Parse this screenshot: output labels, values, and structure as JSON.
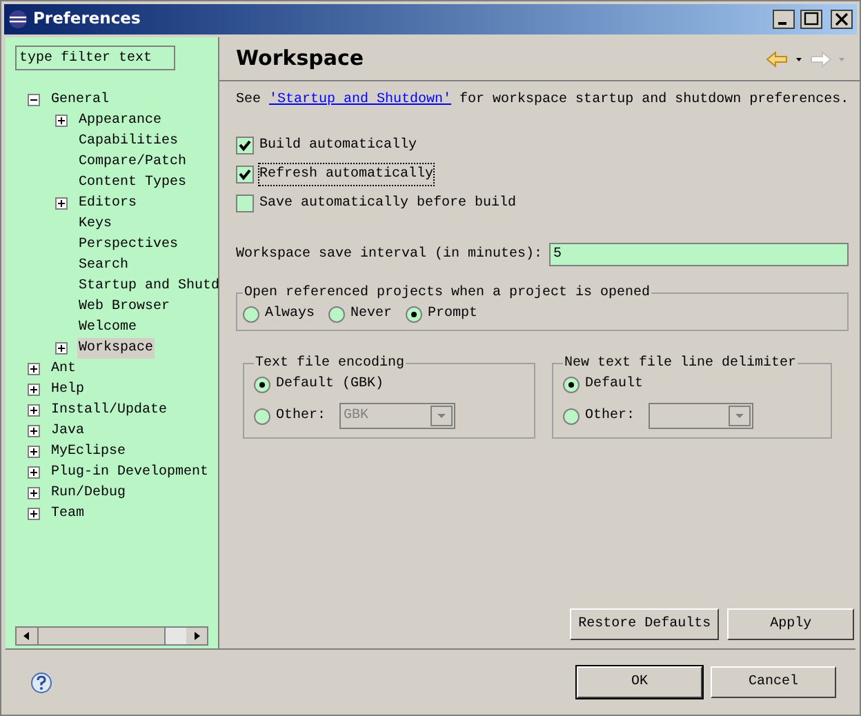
{
  "window": {
    "title": "Preferences"
  },
  "filter": {
    "placeholder": "type filter text"
  },
  "tree": [
    {
      "label": "General",
      "expanded": true,
      "selected": false,
      "children": [
        {
          "label": "Appearance",
          "expanded": false,
          "selected": false
        },
        {
          "label": "Capabilities",
          "selected": false
        },
        {
          "label": "Compare/Patch",
          "selected": false
        },
        {
          "label": "Content Types",
          "selected": false
        },
        {
          "label": "Editors",
          "expanded": false,
          "selected": false
        },
        {
          "label": "Keys",
          "selected": false
        },
        {
          "label": "Perspectives",
          "selected": false
        },
        {
          "label": "Search",
          "selected": false
        },
        {
          "label": "Startup and Shutd",
          "selected": false
        },
        {
          "label": "Web Browser",
          "selected": false
        },
        {
          "label": "Welcome",
          "selected": false
        },
        {
          "label": "Workspace",
          "expanded": false,
          "selected": true
        }
      ]
    },
    {
      "label": "Ant",
      "expanded": false,
      "selected": false
    },
    {
      "label": "Help",
      "expanded": false,
      "selected": false
    },
    {
      "label": "Install/Update",
      "expanded": false,
      "selected": false
    },
    {
      "label": "Java",
      "expanded": false,
      "selected": false
    },
    {
      "label": "MyEclipse",
      "expanded": false,
      "selected": false
    },
    {
      "label": "Plug-in Development",
      "expanded": false,
      "selected": false
    },
    {
      "label": "Run/Debug",
      "expanded": false,
      "selected": false
    },
    {
      "label": "Team",
      "expanded": false,
      "selected": false
    }
  ],
  "page": {
    "title": "Workspace",
    "intro": {
      "before": "See",
      "link": "'Startup and Shutdown'",
      "after": "for workspace startup and shutdown preferences."
    },
    "checkboxes": [
      {
        "label": "Build automatically",
        "checked": true
      },
      {
        "label": "Refresh automatically",
        "checked": true
      },
      {
        "label": "Save automatically before build",
        "checked": false
      }
    ],
    "interval": {
      "label": "Workspace save interval (in minutes):",
      "value": "5"
    },
    "open_projects": {
      "title": "Open referenced projects when a project is opened",
      "options": [
        {
          "label": "Always",
          "selected": false
        },
        {
          "label": "Never",
          "selected": false
        },
        {
          "label": "Prompt",
          "selected": true
        }
      ]
    },
    "groups": [
      {
        "title": "Text file encoding",
        "options": [
          {
            "label": "Default (GBK)",
            "selected": true
          },
          {
            "label": "Other:",
            "selected": false
          }
        ],
        "dropdown": {
          "value": "GBK",
          "disabled": true
        }
      },
      {
        "title": "New text file line delimiter",
        "options": [
          {
            "label": "Default",
            "selected": true
          },
          {
            "label": "Other:",
            "selected": false
          }
        ],
        "dropdown": {
          "disabled": true
        }
      }
    ],
    "buttons": [
      "Restore Defaults",
      "Apply"
    ]
  },
  "footer": {
    "buttons": [
      "OK",
      "Cancel"
    ]
  }
}
